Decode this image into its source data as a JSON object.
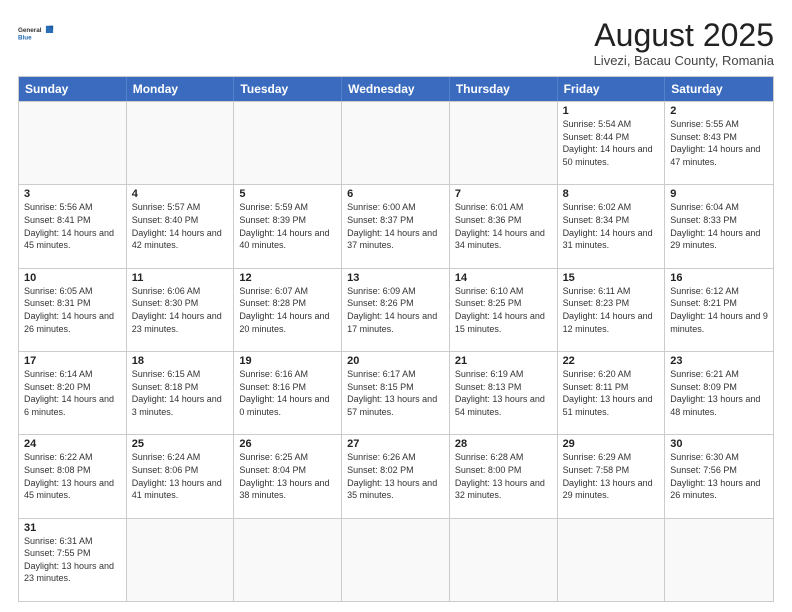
{
  "header": {
    "logo_general": "General",
    "logo_blue": "Blue",
    "month_title": "August 2025",
    "subtitle": "Livezi, Bacau County, Romania"
  },
  "weekdays": [
    "Sunday",
    "Monday",
    "Tuesday",
    "Wednesday",
    "Thursday",
    "Friday",
    "Saturday"
  ],
  "rows": [
    [
      {
        "day": "",
        "info": ""
      },
      {
        "day": "",
        "info": ""
      },
      {
        "day": "",
        "info": ""
      },
      {
        "day": "",
        "info": ""
      },
      {
        "day": "",
        "info": ""
      },
      {
        "day": "1",
        "info": "Sunrise: 5:54 AM\nSunset: 8:44 PM\nDaylight: 14 hours and 50 minutes."
      },
      {
        "day": "2",
        "info": "Sunrise: 5:55 AM\nSunset: 8:43 PM\nDaylight: 14 hours and 47 minutes."
      }
    ],
    [
      {
        "day": "3",
        "info": "Sunrise: 5:56 AM\nSunset: 8:41 PM\nDaylight: 14 hours and 45 minutes."
      },
      {
        "day": "4",
        "info": "Sunrise: 5:57 AM\nSunset: 8:40 PM\nDaylight: 14 hours and 42 minutes."
      },
      {
        "day": "5",
        "info": "Sunrise: 5:59 AM\nSunset: 8:39 PM\nDaylight: 14 hours and 40 minutes."
      },
      {
        "day": "6",
        "info": "Sunrise: 6:00 AM\nSunset: 8:37 PM\nDaylight: 14 hours and 37 minutes."
      },
      {
        "day": "7",
        "info": "Sunrise: 6:01 AM\nSunset: 8:36 PM\nDaylight: 14 hours and 34 minutes."
      },
      {
        "day": "8",
        "info": "Sunrise: 6:02 AM\nSunset: 8:34 PM\nDaylight: 14 hours and 31 minutes."
      },
      {
        "day": "9",
        "info": "Sunrise: 6:04 AM\nSunset: 8:33 PM\nDaylight: 14 hours and 29 minutes."
      }
    ],
    [
      {
        "day": "10",
        "info": "Sunrise: 6:05 AM\nSunset: 8:31 PM\nDaylight: 14 hours and 26 minutes."
      },
      {
        "day": "11",
        "info": "Sunrise: 6:06 AM\nSunset: 8:30 PM\nDaylight: 14 hours and 23 minutes."
      },
      {
        "day": "12",
        "info": "Sunrise: 6:07 AM\nSunset: 8:28 PM\nDaylight: 14 hours and 20 minutes."
      },
      {
        "day": "13",
        "info": "Sunrise: 6:09 AM\nSunset: 8:26 PM\nDaylight: 14 hours and 17 minutes."
      },
      {
        "day": "14",
        "info": "Sunrise: 6:10 AM\nSunset: 8:25 PM\nDaylight: 14 hours and 15 minutes."
      },
      {
        "day": "15",
        "info": "Sunrise: 6:11 AM\nSunset: 8:23 PM\nDaylight: 14 hours and 12 minutes."
      },
      {
        "day": "16",
        "info": "Sunrise: 6:12 AM\nSunset: 8:21 PM\nDaylight: 14 hours and 9 minutes."
      }
    ],
    [
      {
        "day": "17",
        "info": "Sunrise: 6:14 AM\nSunset: 8:20 PM\nDaylight: 14 hours and 6 minutes."
      },
      {
        "day": "18",
        "info": "Sunrise: 6:15 AM\nSunset: 8:18 PM\nDaylight: 14 hours and 3 minutes."
      },
      {
        "day": "19",
        "info": "Sunrise: 6:16 AM\nSunset: 8:16 PM\nDaylight: 14 hours and 0 minutes."
      },
      {
        "day": "20",
        "info": "Sunrise: 6:17 AM\nSunset: 8:15 PM\nDaylight: 13 hours and 57 minutes."
      },
      {
        "day": "21",
        "info": "Sunrise: 6:19 AM\nSunset: 8:13 PM\nDaylight: 13 hours and 54 minutes."
      },
      {
        "day": "22",
        "info": "Sunrise: 6:20 AM\nSunset: 8:11 PM\nDaylight: 13 hours and 51 minutes."
      },
      {
        "day": "23",
        "info": "Sunrise: 6:21 AM\nSunset: 8:09 PM\nDaylight: 13 hours and 48 minutes."
      }
    ],
    [
      {
        "day": "24",
        "info": "Sunrise: 6:22 AM\nSunset: 8:08 PM\nDaylight: 13 hours and 45 minutes."
      },
      {
        "day": "25",
        "info": "Sunrise: 6:24 AM\nSunset: 8:06 PM\nDaylight: 13 hours and 41 minutes."
      },
      {
        "day": "26",
        "info": "Sunrise: 6:25 AM\nSunset: 8:04 PM\nDaylight: 13 hours and 38 minutes."
      },
      {
        "day": "27",
        "info": "Sunrise: 6:26 AM\nSunset: 8:02 PM\nDaylight: 13 hours and 35 minutes."
      },
      {
        "day": "28",
        "info": "Sunrise: 6:28 AM\nSunset: 8:00 PM\nDaylight: 13 hours and 32 minutes."
      },
      {
        "day": "29",
        "info": "Sunrise: 6:29 AM\nSunset: 7:58 PM\nDaylight: 13 hours and 29 minutes."
      },
      {
        "day": "30",
        "info": "Sunrise: 6:30 AM\nSunset: 7:56 PM\nDaylight: 13 hours and 26 minutes."
      }
    ],
    [
      {
        "day": "31",
        "info": "Sunrise: 6:31 AM\nSunset: 7:55 PM\nDaylight: 13 hours and 23 minutes."
      },
      {
        "day": "",
        "info": ""
      },
      {
        "day": "",
        "info": ""
      },
      {
        "day": "",
        "info": ""
      },
      {
        "day": "",
        "info": ""
      },
      {
        "day": "",
        "info": ""
      },
      {
        "day": "",
        "info": ""
      }
    ]
  ]
}
